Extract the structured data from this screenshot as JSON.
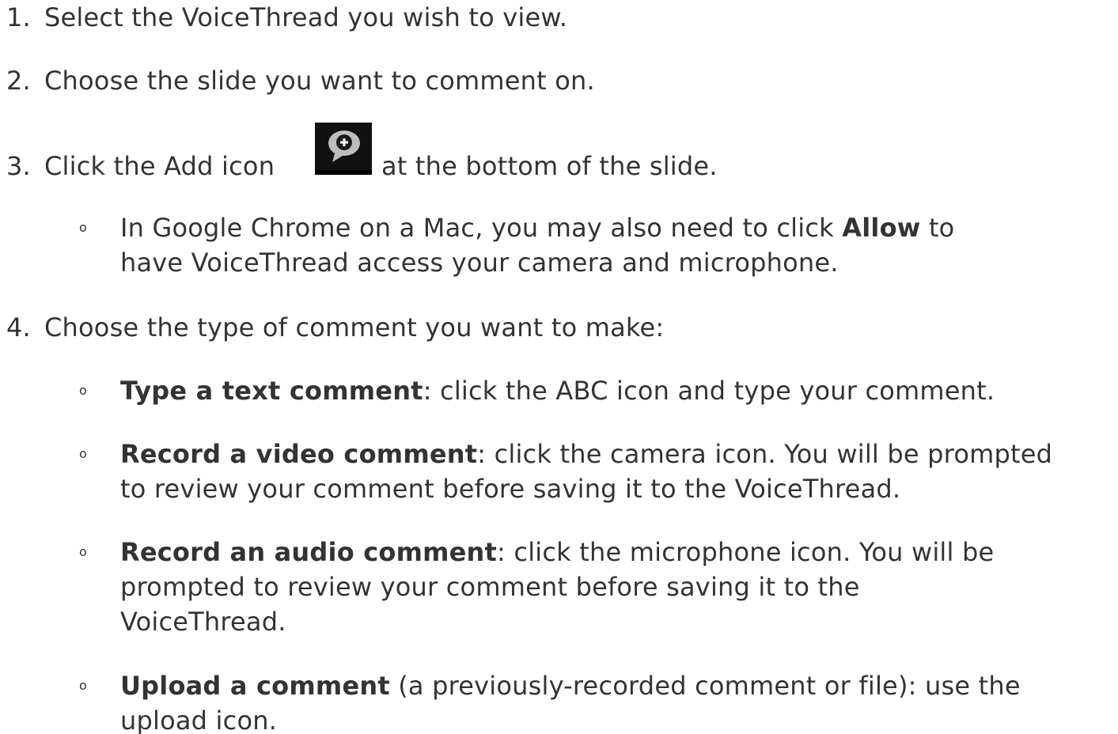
{
  "steps": [
    {
      "num": "1.",
      "text": "Select the VoiceThread you wish to view."
    },
    {
      "num": "2.",
      "text": "Choose the slide you want to comment on."
    },
    {
      "num": "3.",
      "before": "Click the Add icon",
      "after": "at the bottom of the slide."
    },
    {
      "num": "4.",
      "text": "Choose the type of comment you want to make:"
    }
  ],
  "step3_sub": {
    "bullet": "o",
    "line1_before": "In Google Chrome on a Mac, you may also need to click",
    "line1_bold": "Allow",
    "line1_after": "to",
    "line2": "have VoiceThread access your camera and microphone."
  },
  "step4_subs": [
    {
      "bullet": "o",
      "bold": "Type a text comment",
      "rest": ": click the ABC icon and type your comment."
    },
    {
      "bullet": "o",
      "bold": "Record a video comment",
      "rest": ": click the camera icon. You will be prompted",
      "line2": "to review your comment before saving it to the VoiceThread."
    },
    {
      "bullet": "o",
      "bold": "Record an audio comment",
      "rest": ": click the microphone icon. You will be",
      "line2": "prompted to review your comment before saving it to the",
      "line3": "VoiceThread."
    },
    {
      "bullet": "o",
      "bold": "Upload a comment",
      "rest": " (a previously-recorded comment or file): use the",
      "line2": "upload icon."
    }
  ],
  "icons": {
    "add_comment": "add-comment-bubble-icon"
  },
  "colors": {
    "text": "#333333",
    "icon_bg": "#111111",
    "icon_bubble": "#bdbdbd"
  }
}
